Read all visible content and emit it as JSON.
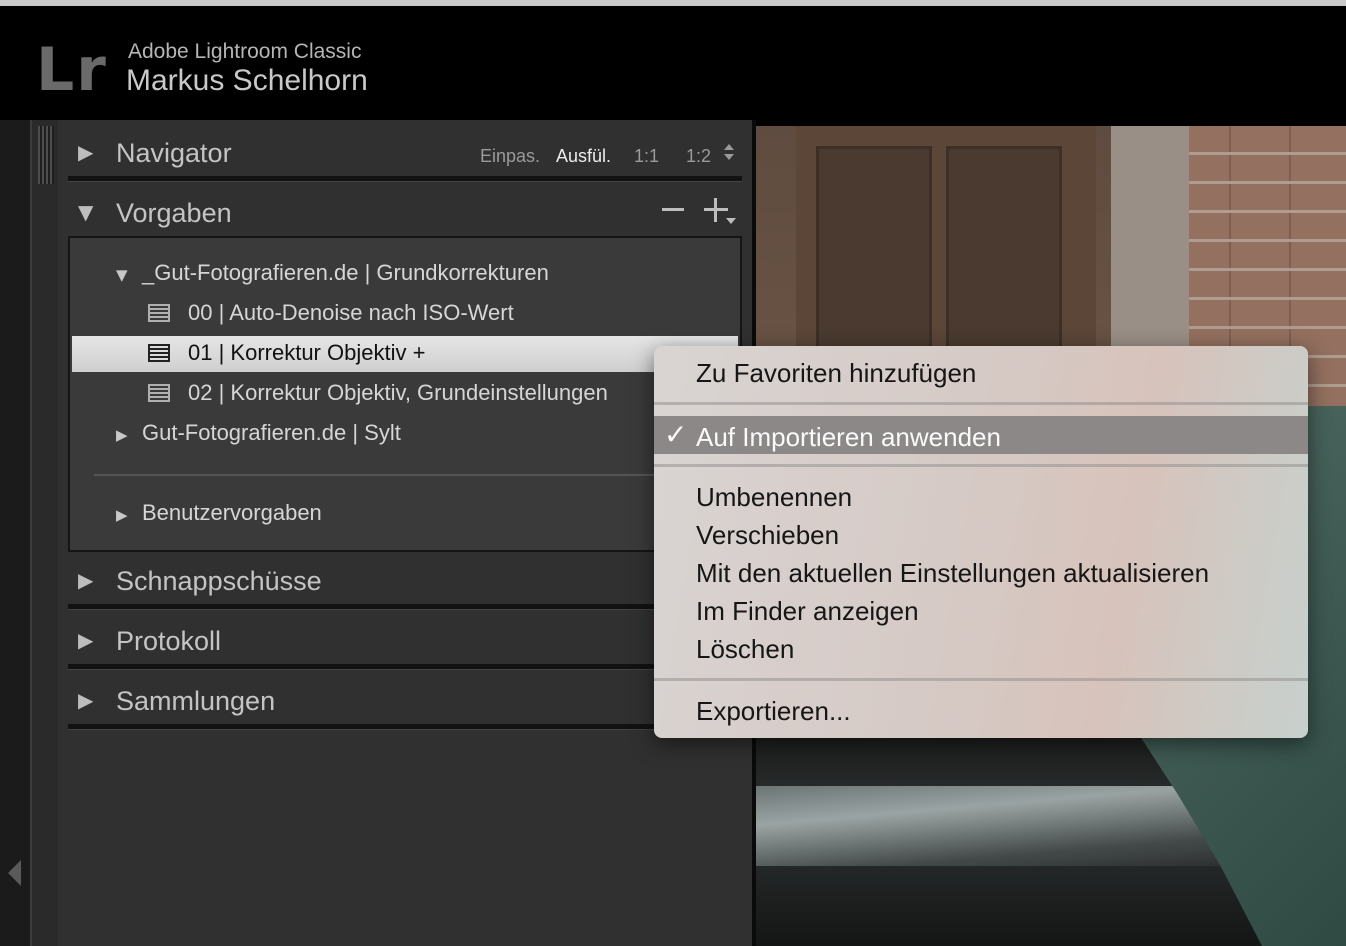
{
  "app": {
    "logo": "Lr",
    "product_name": "Adobe Lightroom Classic",
    "user_name": "Markus Schelhorn"
  },
  "navigator": {
    "title": "Navigator",
    "zoom_options": [
      "Einpas.",
      "Ausfül.",
      "1:1",
      "1:2"
    ],
    "active_zoom": "Ausfül."
  },
  "presets": {
    "title": "Vorgaben",
    "folders": [
      {
        "name": "_Gut-Fotografieren.de | Grundkorrekturen",
        "expanded": true,
        "items": [
          "00 | Auto-Denoise nach ISO-Wert",
          "01 | Korrektur Objektiv  +",
          "02 | Korrektur Objektiv, Grundeinstellungen"
        ]
      },
      {
        "name": "Gut-Fotografieren.de | Sylt",
        "expanded": false
      },
      {
        "name": "Benutzervorgaben",
        "expanded": false
      }
    ],
    "selected_item": "01 | Korrektur Objektiv  +"
  },
  "sections": [
    "Schnappschüsse",
    "Protokoll",
    "Sammlungen"
  ],
  "context_menu": {
    "items": [
      {
        "label": "Zu Favoriten hinzufügen",
        "checked": false
      },
      {
        "label": "Auf Importieren anwenden",
        "checked": true,
        "highlighted": true
      },
      {
        "label": "Umbenennen"
      },
      {
        "label": "Verschieben"
      },
      {
        "label": "Mit den aktuellen Einstellungen aktualisieren"
      },
      {
        "label": "Im Finder anzeigen"
      },
      {
        "label": "Löschen"
      },
      {
        "label": "Exportieren..."
      }
    ],
    "checkmark": "✓"
  },
  "colors": {
    "panel_bg": "#303030",
    "selection_bg": "#dcdcdc",
    "menu_highlight": "#8c8888"
  }
}
